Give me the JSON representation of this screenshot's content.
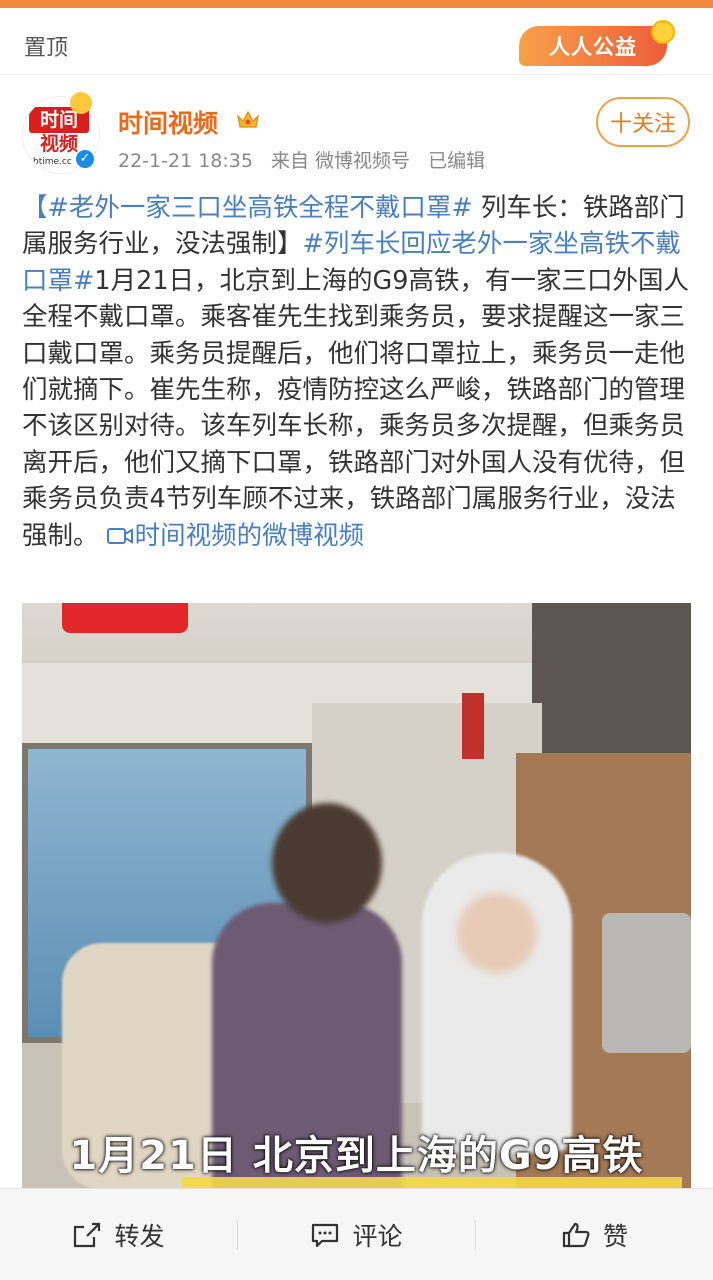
{
  "header": {
    "pin_label": "置顶",
    "charity_label": "人人公益"
  },
  "author": {
    "name": "时间视频",
    "logo_line1": "时间",
    "logo_line2": "视频",
    "logo_domain": "btime.cc",
    "verified_mark": "✓",
    "time": "22-1-21 18:35",
    "source": "来自 微博视频号",
    "edited": "已编辑",
    "follow_label": "十关注"
  },
  "post": {
    "tag1": "【#老外一家三口坐高铁全程不戴口罩#",
    "text1": " 列车长：铁路部门属服务行业，没法强制】",
    "tag2": "#列车长回应老外一家坐高铁不戴口罩#",
    "text2": "1月21日，北京到上海的G9高铁，有一家三口外国人全程不戴口罩。乘客崔先生找到乘务员，要求提醒这一家三口戴口罩。乘务员提醒后，他们将口罩拉上，乘务员一走他们就摘下。崔先生称，疫情防控这么严峻，铁路部门的管理不该区别对待。该车列车长称，乘务员多次提醒，但乘务员离开后，他们又摘下口罩，铁路部门对外国人没有优待，但乘务员负责4节列车顾不过来，铁路部门属服务行业，没法强制。",
    "video_link": "时间视频的微博视频"
  },
  "video": {
    "caption": "1月21日 北京到上海的G9高铁"
  },
  "actions": {
    "repost": "转发",
    "comment": "评论",
    "like": "赞"
  },
  "colors": {
    "accent": "#f28a3c",
    "author": "#e86b1c",
    "link": "#4a7fbf"
  }
}
